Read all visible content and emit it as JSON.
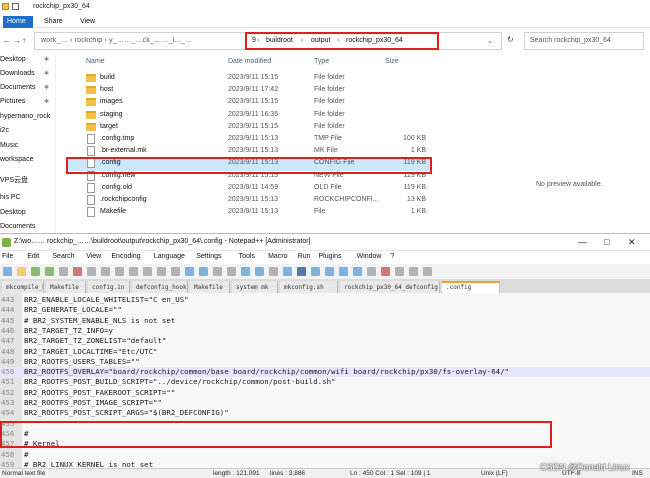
{
  "explorer": {
    "title": "rockchip_px30_64",
    "ribbon_tabs": [
      "Home",
      "Share",
      "View"
    ],
    "nav": {
      "back": "←",
      "forward": "→",
      "up": "↑",
      "refresh": "↻",
      "expand": "⌄"
    },
    "breadcrumb_blurred": "work_… › rockchip › y_……_…ck_……_l..._…",
    "breadcrumb": [
      "9",
      "buildroot",
      "output",
      "rockchip_px30_64"
    ],
    "search_placeholder": "Search rockchip_px30_64",
    "sidebar": [
      {
        "label": "Desktop",
        "pinned": true
      },
      {
        "label": "Downloads",
        "pinned": true
      },
      {
        "label": "Documents",
        "pinned": true
      },
      {
        "label": "Pictures",
        "pinned": true
      },
      {
        "label": "hypernano_rock",
        "pinned": false
      },
      {
        "label": "i2c",
        "pinned": false
      },
      {
        "label": "Music",
        "pinned": false
      },
      {
        "label": "workspace",
        "pinned": false
      },
      {
        "label": "VPS云盘",
        "pinned": false
      },
      {
        "label": "his PC",
        "pinned": false
      },
      {
        "label": "Desktop",
        "pinned": false
      },
      {
        "label": "Documents",
        "pinned": false
      }
    ],
    "columns": {
      "name": "Name",
      "date": "Date modified",
      "type": "Type",
      "size": "Size"
    },
    "files": [
      {
        "name": "build",
        "date": "2023/9/11 15:15",
        "type": "File folder",
        "size": "",
        "kind": "folder"
      },
      {
        "name": "host",
        "date": "2023/9/11 17:42",
        "type": "File folder",
        "size": "",
        "kind": "folder"
      },
      {
        "name": "images",
        "date": "2023/9/11 15:15",
        "type": "File folder",
        "size": "",
        "kind": "folder"
      },
      {
        "name": "staging",
        "date": "2023/9/11 16:35",
        "type": "File folder",
        "size": "",
        "kind": "folder"
      },
      {
        "name": "target",
        "date": "2023/9/11 15:15",
        "type": "File folder",
        "size": "",
        "kind": "folder"
      },
      {
        "name": ".config.tmp",
        "date": "2023/9/11 15:13",
        "type": "TMP File",
        "size": "100 KB",
        "kind": "file"
      },
      {
        "name": ".br-external.mk",
        "date": "2023/9/11 15:13",
        "type": "MK File",
        "size": "1 KB",
        "kind": "file"
      },
      {
        "name": ".config",
        "date": "2023/9/11 15:13",
        "type": "CONFIG File",
        "size": "119 KB",
        "kind": "file"
      },
      {
        "name": ".config.new",
        "date": "2023/9/11 15:13",
        "type": "NEW File",
        "size": "119 KB",
        "kind": "file"
      },
      {
        "name": ".config.old",
        "date": "2023/9/11 14:59",
        "type": "OLD File",
        "size": "119 KB",
        "kind": "file"
      },
      {
        "name": ".rockchipconfig",
        "date": "2023/9/11 15:13",
        "type": "ROCKCHIPCONFI...",
        "size": "13 KB",
        "kind": "file"
      },
      {
        "name": "Makefile",
        "date": "2023/9/11 15:13",
        "type": "File",
        "size": "1 KB",
        "kind": "file"
      }
    ],
    "preview_text": "No preview available."
  },
  "npp": {
    "title": "Z:\\wo…… rockchip_……\\buildroot\\output\\rockchip_px30_64\\.config - Notepad++ [Administrator]",
    "controls": {
      "min": "—",
      "max": "□",
      "close": "✕"
    },
    "menu": [
      "File",
      "Edit",
      "Search",
      "View",
      "Encoding",
      "Language",
      "Settings",
      "Tools",
      "Macro",
      "Run",
      "Plugins",
      "Window",
      "?"
    ],
    "tabs": [
      "mkcompile_h",
      "Makefile",
      "config.in",
      "defconfig_hook.py",
      "Makefile",
      "system mk",
      "mkconfig.sh",
      "rockchip_px30_64_defconfig",
      ".config"
    ],
    "lines": [
      {
        "n": "443",
        "text": "BR2_ENABLE_LOCALE_WHITELIST=\"C en_US\""
      },
      {
        "n": "444",
        "text": "BR2_GENERATE_LOCALE=\"\""
      },
      {
        "n": "445",
        "text": "# BR2_SYSTEM_ENABLE_NLS is not set"
      },
      {
        "n": "446",
        "text": "BR2_TARGET_TZ_INFO=y"
      },
      {
        "n": "447",
        "text": "BR2_TARGET_TZ_ZONELIST=\"default\""
      },
      {
        "n": "448",
        "text": "BR2_TARGET_LOCALTIME=\"Etc/UTC\""
      },
      {
        "n": "449",
        "text": "BR2_ROOTFS_USERS_TABLES=\"\""
      },
      {
        "n": "450",
        "text": "BR2_ROOTFS_OVERLAY=\"board/rockchip/common/base board/rockchip/common/wifi board/rockchip/px30/fs-overlay-64/\""
      },
      {
        "n": "451",
        "text": "BR2_ROOTFS_POST_BUILD_SCRIPT=\"../device/rockchip/common/post-build.sh\""
      },
      {
        "n": "452",
        "text": "BR2_ROOTFS_POST_FAKEROOT_SCRIPT=\"\""
      },
      {
        "n": "453",
        "text": "BR2_ROOTFS_POST_IMAGE_SCRIPT=\"\""
      },
      {
        "n": "454",
        "text": "BR2_ROOTFS_POST_SCRIPT_ARGS=\"$(BR2_DEFCONFIG)\""
      },
      {
        "n": "455",
        "text": ""
      },
      {
        "n": "456",
        "text": "#"
      },
      {
        "n": "457",
        "text": "# Kernel"
      },
      {
        "n": "458",
        "text": "#"
      },
      {
        "n": "459",
        "text": "# BR2_LINUX_KERNEL is not set"
      }
    ],
    "status": {
      "type": "Normal text file",
      "length": "length : 121,091",
      "lines": "lines : 3,886",
      "pos": "Ln : 450    Col : 1    Sel : 109 | 1",
      "eol": "Unix (LF)",
      "enc": "UTF-8",
      "ins": "INS"
    },
    "watermark": "CSDN @Donald Linux"
  }
}
